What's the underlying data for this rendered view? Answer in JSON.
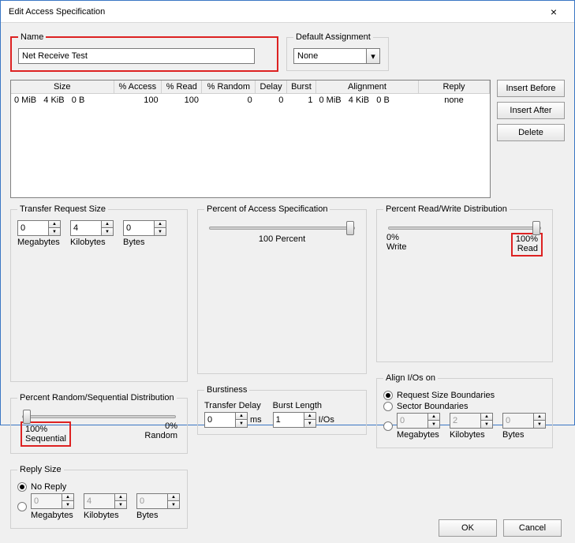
{
  "window": {
    "title": "Edit Access Specification",
    "close_icon": "×"
  },
  "name_group": {
    "legend": "Name",
    "value": "Net Receive Test"
  },
  "default_group": {
    "legend": "Default Assignment",
    "value": "None"
  },
  "grid": {
    "headers": {
      "size": "Size",
      "access": "% Access",
      "read": "% Read",
      "random": "% Random",
      "delay": "Delay",
      "burst": "Burst",
      "alignment": "Alignment",
      "reply": "Reply"
    },
    "row": {
      "size_mib": "0 MiB",
      "size_kib": "4 KiB",
      "size_b": "0 B",
      "access": "100",
      "read": "100",
      "random": "0",
      "delay": "0",
      "burst": "1",
      "align_mib": "0 MiB",
      "align_kib": "4 KiB",
      "align_b": "0 B",
      "reply": "none"
    }
  },
  "side_buttons": {
    "insert_before": "Insert Before",
    "insert_after": "Insert After",
    "delete": "Delete"
  },
  "trs": {
    "legend": "Transfer Request Size",
    "mb_val": "0",
    "kb_val": "4",
    "b_val": "0",
    "mb_lbl": "Megabytes",
    "kb_lbl": "Kilobytes",
    "b_lbl": "Bytes"
  },
  "pas": {
    "legend": "Percent of Access Specification",
    "value_label": "100 Percent"
  },
  "rw": {
    "legend": "Percent Read/Write Distribution",
    "left_pct": "0%",
    "left_lbl": "Write",
    "right_pct": "100%",
    "right_lbl": "Read"
  },
  "rand": {
    "legend": "Percent Random/Sequential Distribution",
    "left_pct": "100%",
    "left_lbl": "Sequential",
    "right_pct": "0%",
    "right_lbl": "Random"
  },
  "burst": {
    "legend": "Burstiness",
    "td_lbl": "Transfer Delay",
    "td_val": "0",
    "td_unit": "ms",
    "bl_lbl": "Burst Length",
    "bl_val": "1",
    "bl_unit": "I/Os"
  },
  "align": {
    "legend": "Align I/Os on",
    "opt1": "Request Size Boundaries",
    "opt2": "Sector Boundaries",
    "mb_val": "0",
    "kb_val": "2",
    "b_val": "0",
    "mb_lbl": "Megabytes",
    "kb_lbl": "Kilobytes",
    "b_lbl": "Bytes"
  },
  "reply": {
    "legend": "Reply Size",
    "noreply": "No Reply",
    "mb_val": "0",
    "kb_val": "4",
    "b_val": "0",
    "mb_lbl": "Megabytes",
    "kb_lbl": "Kilobytes",
    "b_lbl": "Bytes"
  },
  "bottom": {
    "ok": "OK",
    "cancel": "Cancel"
  }
}
